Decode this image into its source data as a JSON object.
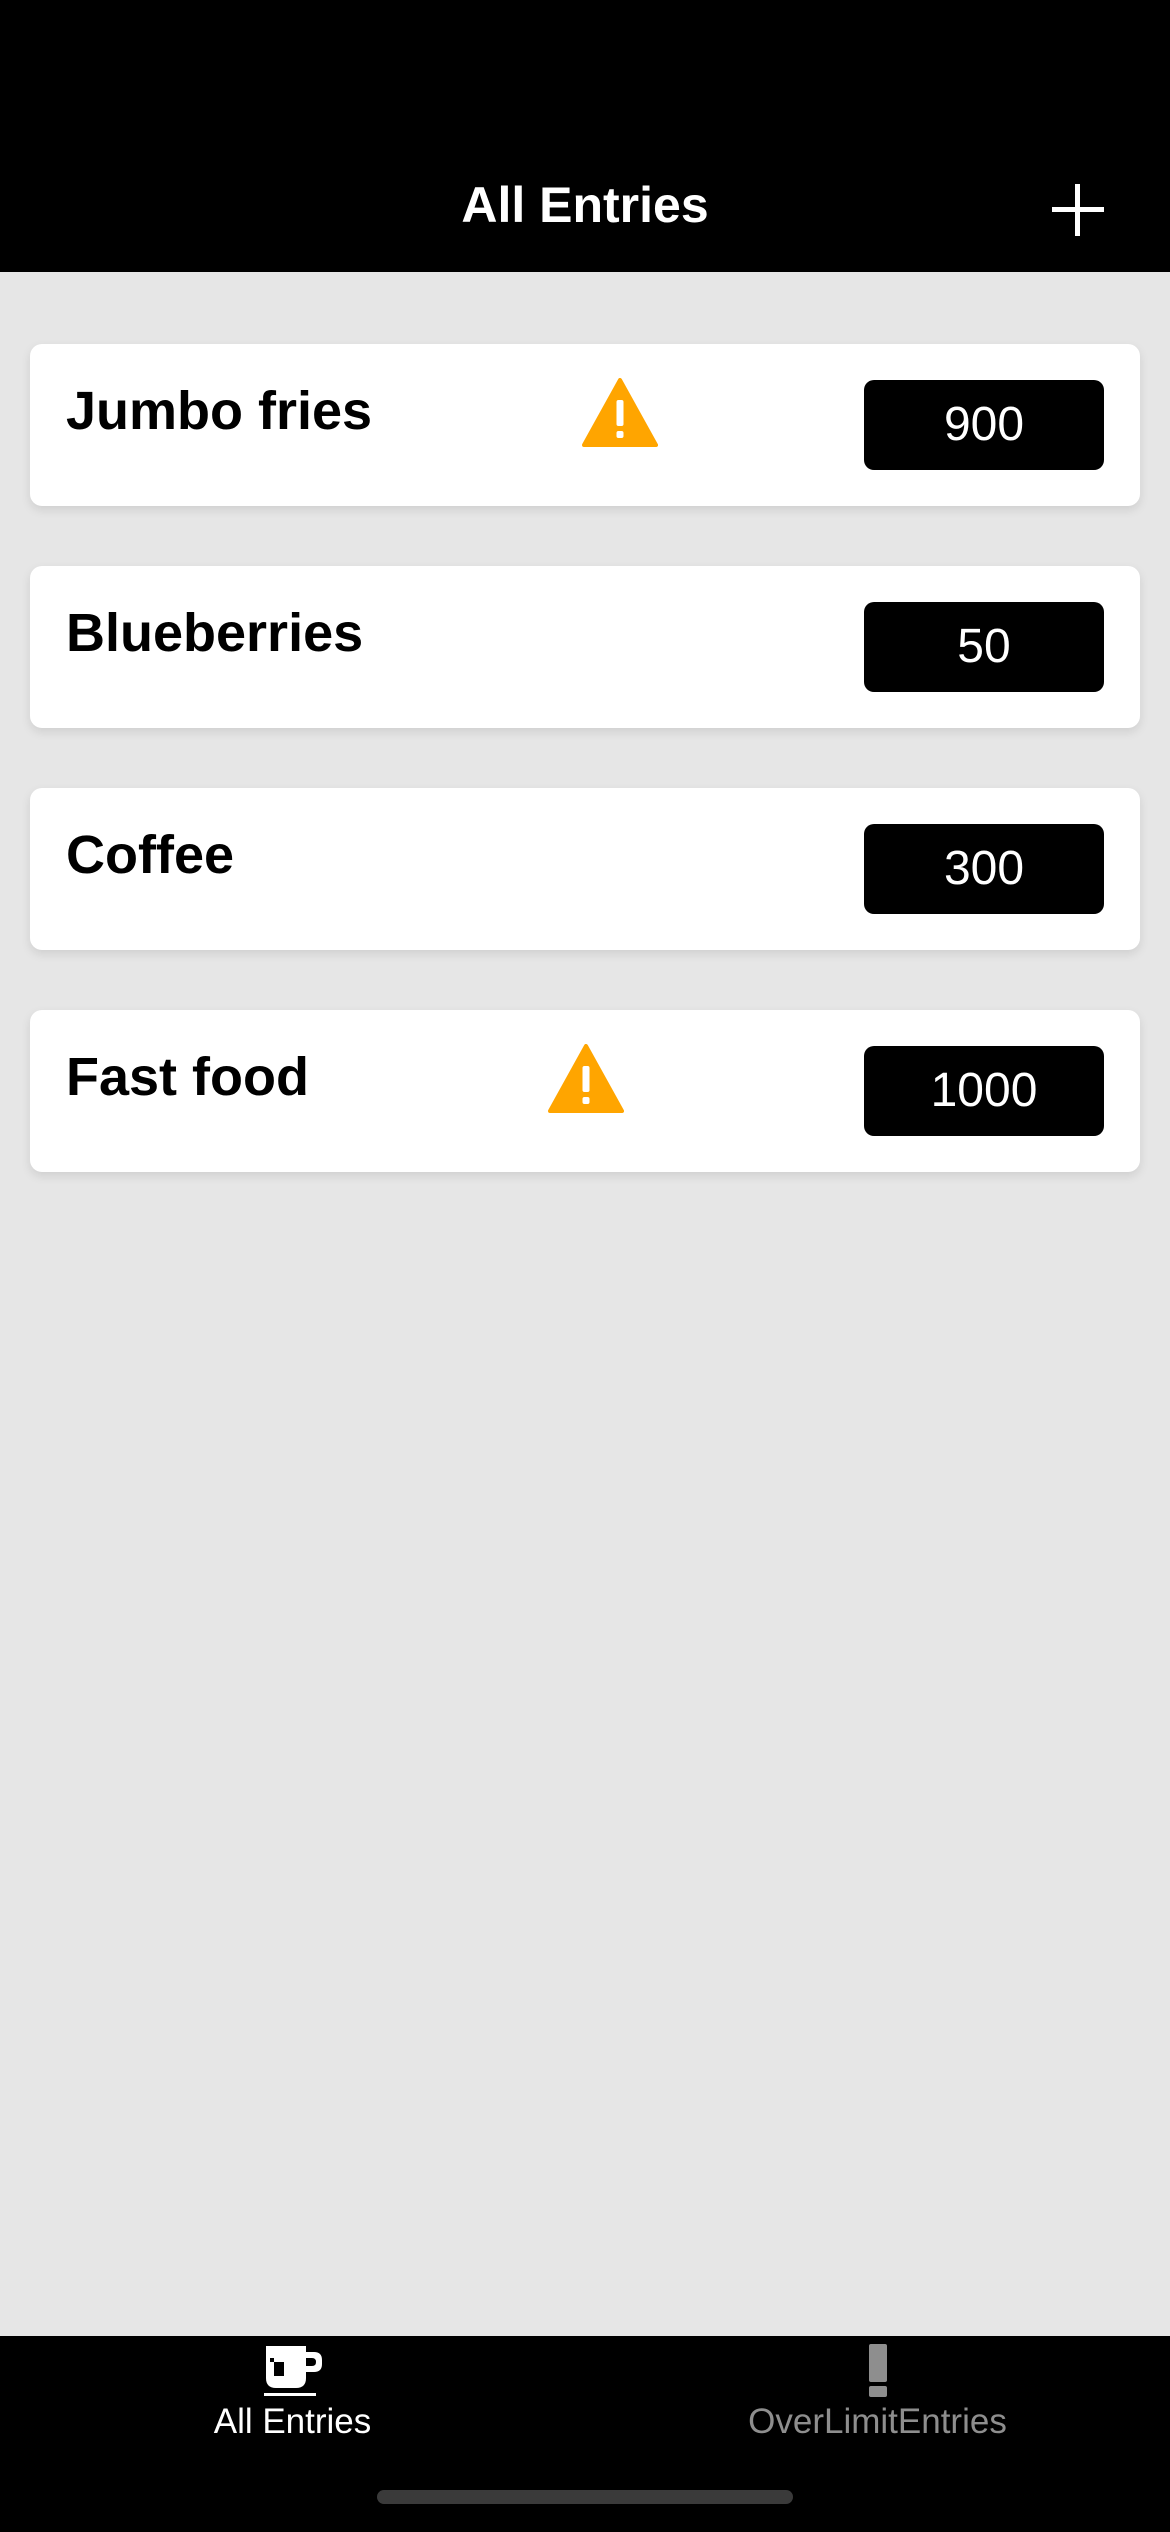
{
  "header": {
    "title": "All Entries",
    "add_icon": "plus-icon"
  },
  "entries": [
    {
      "name": "Jumbo fries",
      "value": "900",
      "over_limit": true
    },
    {
      "name": "Blueberries",
      "value": "50",
      "over_limit": false
    },
    {
      "name": "Coffee",
      "value": "300",
      "over_limit": false
    },
    {
      "name": "Fast food",
      "value": "1000",
      "over_limit": true
    }
  ],
  "tabbar": {
    "tabs": [
      {
        "label": "All Entries",
        "icon": "coffee-cup-icon",
        "active": true
      },
      {
        "label": "OverLimitEntries",
        "icon": "exclamation-icon",
        "active": false
      }
    ]
  },
  "colors": {
    "header_bg": "#000000",
    "screen_bg": "#e6e6e6",
    "warning": "#ffa500",
    "value_bg": "#000000",
    "tab_inactive": "#8e8e8e"
  }
}
